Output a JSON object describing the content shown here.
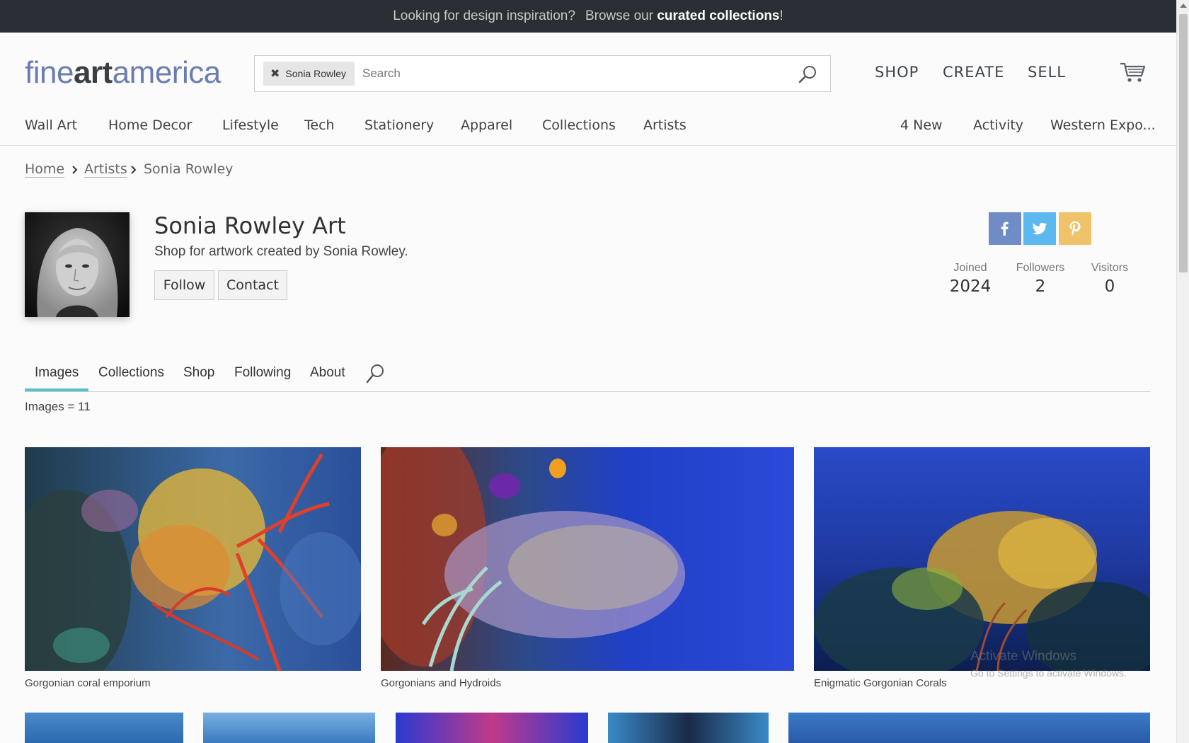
{
  "promo": {
    "question": "Looking for design inspiration?",
    "lead": "Browse our",
    "link": "curated collections",
    "end": "!"
  },
  "logo": {
    "part1": "fine",
    "part2": "art",
    "part3": "america"
  },
  "search": {
    "chip_label": "Sonia Rowley",
    "placeholder": "Search"
  },
  "top_nav": {
    "shop": "SHOP",
    "create": "CREATE",
    "sell": "SELL"
  },
  "category_nav": [
    "Wall Art",
    "Home Decor",
    "Lifestyle",
    "Tech",
    "Stationery",
    "Apparel",
    "Collections",
    "Artists"
  ],
  "right_nav": [
    "4 New",
    "Activity",
    "Western Expo..."
  ],
  "breadcrumb": [
    "Home",
    "Artists",
    "Sonia Rowley"
  ],
  "artist": {
    "title": "Sonia Rowley Art",
    "subtitle": "Shop for artwork created by Sonia Rowley.",
    "follow_label": "Follow",
    "contact_label": "Contact"
  },
  "social": {
    "facebook_color": "#6f8cc7",
    "twitter_color": "#5cb8ef",
    "pinterest_color": "#f0c26a"
  },
  "stats": [
    {
      "label": "Joined",
      "value": "2024"
    },
    {
      "label": "Followers",
      "value": "2"
    },
    {
      "label": "Visitors",
      "value": "0"
    }
  ],
  "tabs": [
    "Images",
    "Collections",
    "Shop",
    "Following",
    "About"
  ],
  "images_count": "Images = 11",
  "gallery": [
    {
      "caption": "Gorgonian coral emporium"
    },
    {
      "caption": "Gorgonians and Hydroids"
    },
    {
      "caption": "Enigmatic Gorgonian Corals"
    }
  ],
  "watermark": {
    "line1": "Activate Windows",
    "line2": "Go to Settings to activate Windows."
  },
  "accent_color": "#5bc0cc"
}
